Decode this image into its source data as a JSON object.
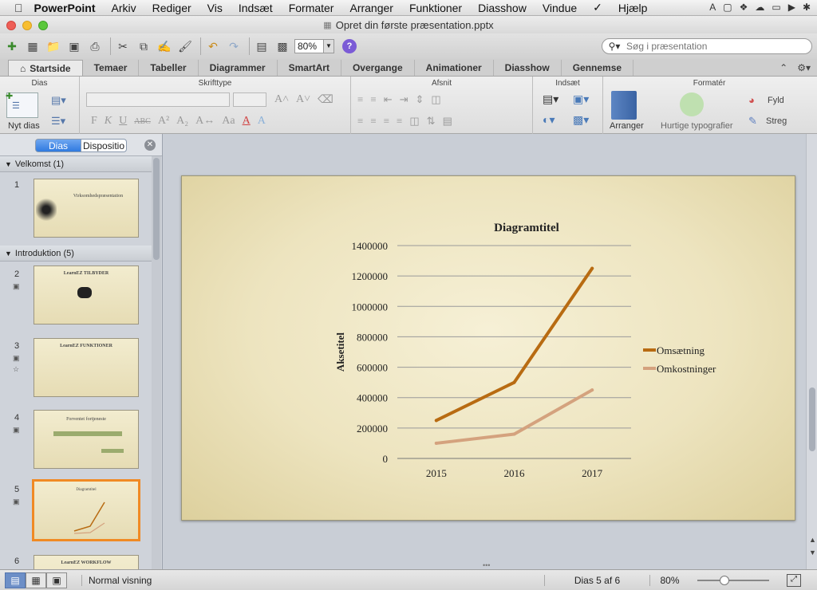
{
  "menubar": {
    "app": "PowerPoint",
    "items": [
      "Arkiv",
      "Rediger",
      "Vis",
      "Indsæt",
      "Formater",
      "Arranger",
      "Funktioner",
      "Diasshow",
      "Vindue",
      "Hjælp"
    ]
  },
  "window": {
    "title": "Opret din første præsentation.pptx"
  },
  "toolbar": {
    "zoom": "80%"
  },
  "search": {
    "placeholder": "Søg i præsentation"
  },
  "ribbon_tabs": [
    "Startside",
    "Temaer",
    "Tabeller",
    "Diagrammer",
    "SmartArt",
    "Overgange",
    "Animationer",
    "Diasshow",
    "Gennemse"
  ],
  "ribbon": {
    "groups": {
      "dias": "Dias",
      "skrifttype": "Skrifttype",
      "afsnit": "Afsnit",
      "indsaet": "Indsæt",
      "formater": "Formatér"
    },
    "nyt_dias": "Nyt dias",
    "arranger": "Arranger",
    "hurtige": "Hurtige typografier",
    "fyld": "Fyld",
    "streg": "Streg"
  },
  "sidebar": {
    "tab_dias": "Dias",
    "tab_disposition": "Dispositio",
    "sections": [
      {
        "label": "Velkomst (1)"
      },
      {
        "label": "Introduktion (5)"
      }
    ],
    "slides": [
      {
        "num": "1",
        "title": "Virksomhedspræsentation"
      },
      {
        "num": "2",
        "title": "LearnEZ TILBYDER"
      },
      {
        "num": "3",
        "title": "LearnEZ FUNKTIONER"
      },
      {
        "num": "4",
        "title": "Forventet fortjeneste"
      },
      {
        "num": "5",
        "title": "Diagramtitel"
      },
      {
        "num": "6",
        "title": "LearnEZ WORKFLOW"
      }
    ]
  },
  "chart_data": {
    "type": "line",
    "title": "Diagramtitel",
    "xlabel": "",
    "ylabel": "Aksetitel",
    "categories": [
      "2015",
      "2016",
      "2017"
    ],
    "ylim": [
      0,
      1400000
    ],
    "yticks": [
      "0",
      "200000",
      "400000",
      "600000",
      "800000",
      "1000000",
      "1200000",
      "1400000"
    ],
    "grid": true,
    "legend": "right",
    "series": [
      {
        "name": "Omsætning",
        "values": [
          250000,
          500000,
          1250000
        ],
        "color": "#b86b12"
      },
      {
        "name": "Omkostninger",
        "values": [
          100000,
          160000,
          450000
        ],
        "color": "#d4a27e"
      }
    ]
  },
  "statusbar": {
    "view": "Normal visning",
    "slide_counter": "Dias 5 af 6",
    "zoom": "80%"
  }
}
